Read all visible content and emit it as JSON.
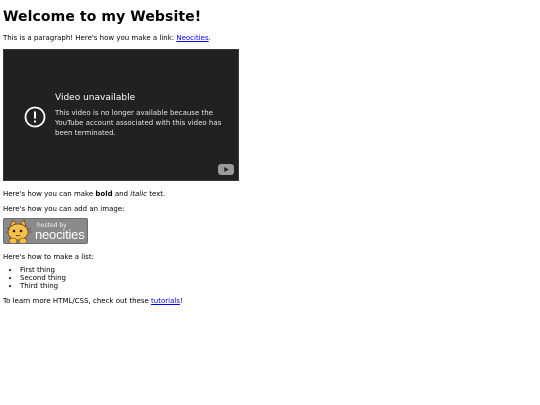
{
  "heading": "Welcome to my Website!",
  "intro": {
    "before_link": "This is a paragraph! Here's how you make a link: ",
    "link_text": "Neocities",
    "after_link": "."
  },
  "video": {
    "title": "Video unavailable",
    "message": "This video is no longer available because the YouTube account associated with this video has been terminated.",
    "icons": [
      "info-icon",
      "youtube-logo-icon"
    ]
  },
  "formatting": {
    "before_bold": "Here's how you can make ",
    "bold_text": "bold",
    "between": " and ",
    "italic_text": "italic",
    "after_italic": " text."
  },
  "image_intro": "Here's how you can add an image:",
  "badge": {
    "small_text": "hosted by",
    "brand_text": "neocities"
  },
  "list_intro": "Here's how to make a list:",
  "list_items": [
    "First thing",
    "Second thing",
    "Third thing"
  ],
  "outro": {
    "before_link": "To learn more HTML/CSS, check out these ",
    "link_text": "tutorials",
    "after_link": "!"
  },
  "colors": {
    "link": "#0000ee",
    "video_bg": "#212121"
  }
}
